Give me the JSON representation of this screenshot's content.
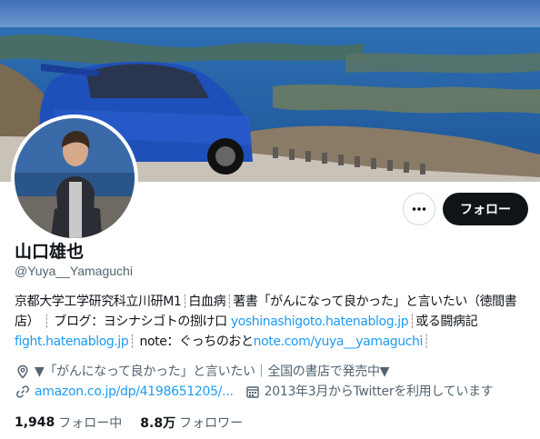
{
  "profile": {
    "display_name": "山口雄也",
    "handle": "@Yuya__Yamaguchi",
    "follow_label": "フォロー",
    "more_icon": "more-dots-icon"
  },
  "bio": {
    "t1": "京都大学工学研究科立川研M1",
    "s1": "┊",
    "t2": "白血病",
    "s2": "┊",
    "t3": "著書「がんになって良かった」と言いたい（徳間書店）",
    "s3": "┊",
    "t4": "ブログ：ヨシナシゴトの捌け口 ",
    "link1": "yoshinashigoto.hatenablog.jp",
    "s4": "┊",
    "t5": "或る闘病記 ",
    "link2": "fight.hatenablog.jp",
    "s5": "┊",
    "t6": "note：ぐっちのおと",
    "link3": "note.com/yuya__yamaguchi",
    "s6": "┊"
  },
  "meta": {
    "location": "▼「がんになって良かった」と言いたい｜全国の書店で発売中▼",
    "url": "amazon.co.jp/dp/4198651205/...",
    "joined": "2013年3月からTwitterを利用しています",
    "location_icon": "location-pin-icon",
    "link_icon": "link-icon",
    "calendar_icon": "calendar-icon"
  },
  "stats": {
    "following_count": "1,948",
    "following_label": "フォロー中",
    "followers_count": "8.8万",
    "followers_label": "フォロワー"
  },
  "colors": {
    "accent": "#1d9bf0",
    "text": "#0f1419",
    "muted": "#536471",
    "follow_bg": "#0f1419"
  }
}
